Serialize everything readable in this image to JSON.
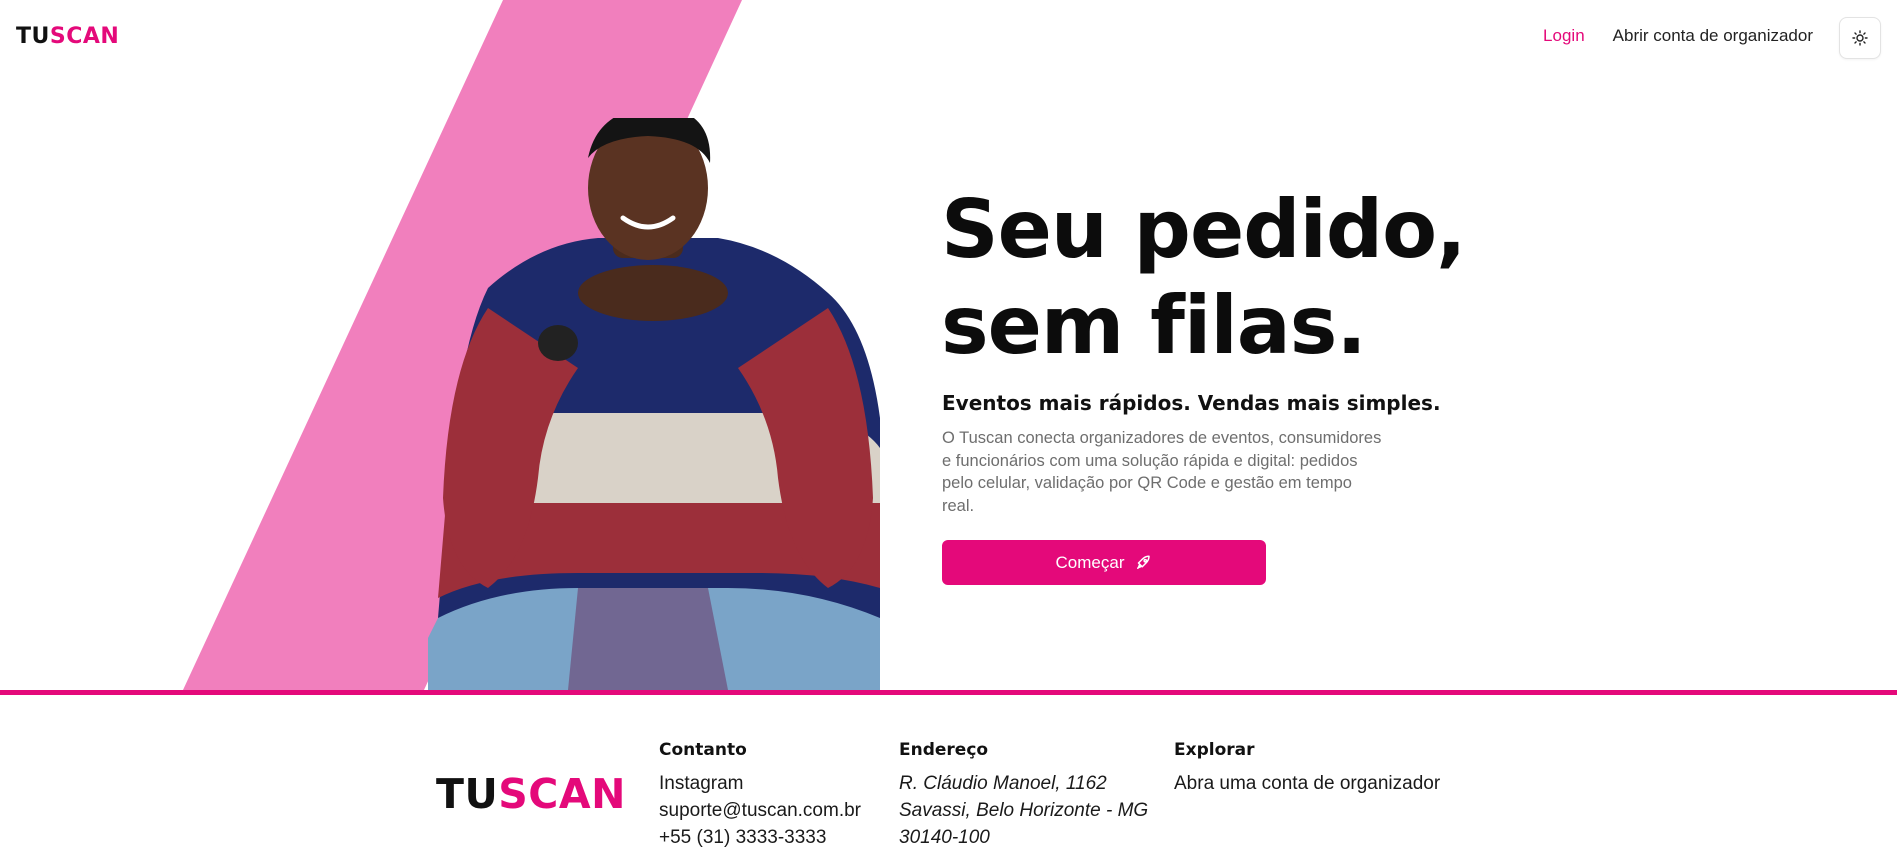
{
  "header": {
    "logo": {
      "part1": "TU",
      "part2": "SCAN"
    },
    "nav": {
      "login": "Login",
      "open_account": "Abrir conta de organizador"
    },
    "theme_toggle_icon": "sun-icon"
  },
  "hero": {
    "title_line1": "Seu pedido,",
    "title_line2": "sem filas.",
    "subtitle": "Eventos mais rápidos. Vendas mais simples.",
    "description": "O Tuscan conecta organizadores de eventos, consumidores e funcionários com uma solução rápida e digital: pedidos pelo celular, validação por QR Code e gestão em tempo real.",
    "cta_label": "Começar",
    "cta_icon": "rocket-icon"
  },
  "footer": {
    "logo": {
      "part1": "TU",
      "part2": "SCAN"
    },
    "contact": {
      "heading": "Contanto",
      "items": [
        "Instagram",
        "suporte@tuscan.com.br",
        "+55 (31) 3333-3333"
      ]
    },
    "address": {
      "heading": "Endereço",
      "lines": [
        "R. Cláudio Manoel, 1162",
        "Savassi, Belo Horizonte - MG",
        "30140-100"
      ]
    },
    "explore": {
      "heading": "Explorar",
      "items": [
        "Abra uma conta de organizador"
      ]
    }
  },
  "colors": {
    "accent": "#e4097a",
    "stripe": "#f17fbd",
    "text": "#111111",
    "muted": "#6e6e6e"
  }
}
